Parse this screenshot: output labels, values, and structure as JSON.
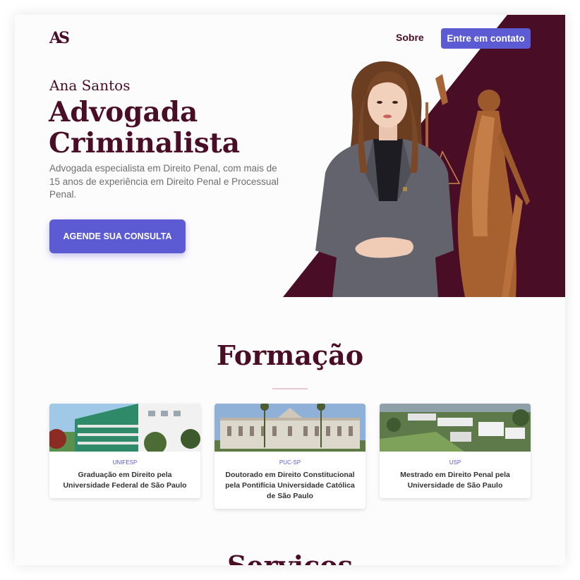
{
  "nav": {
    "logo": "AS",
    "sobre_label": "Sobre",
    "contact_label": "Entre em contato"
  },
  "hero": {
    "name": "Ana Santos",
    "title_line1": "Advogada",
    "title_line2": "Criminalista",
    "description": "Advogada especialista em Direito Penal, com mais de 15 anos de experiência em Direito Penal e Processual Penal.",
    "cta_label": "AGENDE SUA CONSULTA"
  },
  "formacao": {
    "title": "Formação",
    "cards": [
      {
        "tag": "UNIFESP",
        "text": "Graduação em Direito pela Universidade Federal de São Paulo"
      },
      {
        "tag": "PUC-SP",
        "text": "Doutorado em Direito Constitucional pela Pontifícia Universidade Católica de São Paulo"
      },
      {
        "tag": "USP",
        "text": "Mestrado em Direito Penal pela Universidade de São Paulo"
      }
    ]
  },
  "servicos": {
    "title": "Serviços"
  },
  "colors": {
    "brand": "#4a0d26",
    "accent": "#5d5bd4",
    "background": "#fdfcfd"
  }
}
